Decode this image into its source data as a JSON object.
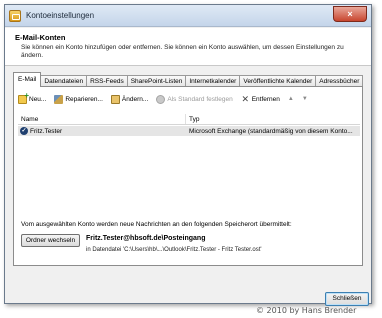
{
  "window": {
    "title": "Kontoeinstellungen",
    "close_glyph": "×"
  },
  "header": {
    "title": "E-Mail-Konten",
    "description": "Sie können ein Konto hinzufügen oder entfernen. Sie können ein Konto auswählen, um dessen Einstellungen zu ändern."
  },
  "tabs": [
    {
      "label": "E-Mail",
      "active": true
    },
    {
      "label": "Datendateien"
    },
    {
      "label": "RSS-Feeds"
    },
    {
      "label": "SharePoint-Listen"
    },
    {
      "label": "Internetkalender"
    },
    {
      "label": "Veröffentlichte Kalender"
    },
    {
      "label": "Adressbücher"
    }
  ],
  "toolbar": {
    "new_label": "Neu...",
    "repair_label": "Reparieren...",
    "change_label": "Ändern...",
    "default_label": "Als Standard festlegen",
    "remove_label": "Entfernen",
    "remove_glyph": "✕",
    "up_glyph": "▲",
    "down_glyph": "▼"
  },
  "grid": {
    "columns": {
      "name": "Name",
      "type": "Typ"
    },
    "rows": [
      {
        "name": "Fritz.Tester",
        "type": "Microsoft Exchange (standardmäßig von diesem Konto...",
        "check_glyph": "✓"
      }
    ]
  },
  "store": {
    "label": "Vom ausgewählten Konto werden neue Nachrichten an den folgenden Speicherort übermittelt:",
    "change_folder_label": "Ordner wechseln",
    "path": "Fritz.Tester@hbsoft.de\\Posteingang",
    "file": "in Datendatei 'C:\\Users\\hb\\...\\Outlook\\Fritz.Tester - Fritz Tester.ost'"
  },
  "footer": {
    "close_label": "Schließen"
  },
  "watermark": "© 2010 by Hans Brender",
  "colors": {
    "titlebar": "#c4d5ea",
    "selected_row": "#e5e5e5",
    "close_button": "#c8452f"
  }
}
